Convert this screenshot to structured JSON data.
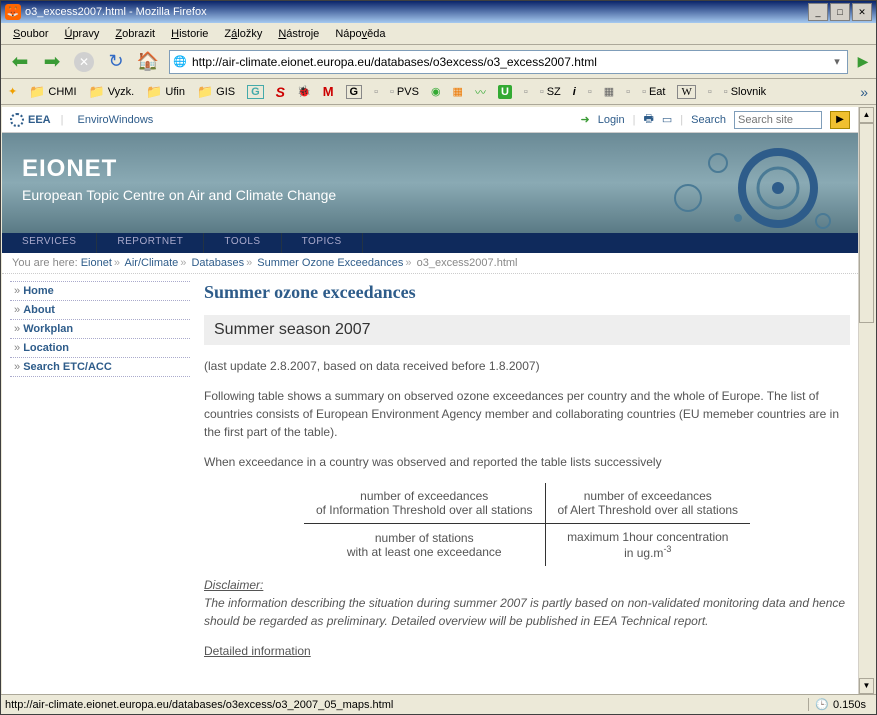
{
  "window": {
    "title": "o3_excess2007.html - Mozilla Firefox"
  },
  "menu": [
    "Soubor",
    "Úpravy",
    "Zobrazit",
    "Historie",
    "Záložky",
    "Nástroje",
    "Nápověda"
  ],
  "url": "http://air-climate.eionet.europa.eu/databases/o3excess/o3_excess2007.html",
  "bookmarks": [
    "CHMI",
    "Vyzk.",
    "Ufin",
    "GIS",
    "G",
    "S",
    "?",
    "M",
    "G",
    "",
    "PVS",
    "",
    "",
    "",
    "U",
    "",
    "SZ",
    "i",
    "",
    "",
    "",
    "Eat",
    "W",
    "",
    "Slovnik"
  ],
  "portal": {
    "eea": "EEA",
    "enviro": "EnviroWindows",
    "login": "Login",
    "search_label": "Search",
    "search_placeholder": "Search site"
  },
  "banner": {
    "title": "EIONET",
    "subtitle": "European Topic Centre on Air and Climate Change"
  },
  "tabs": [
    "SERVICES",
    "REPORTNET",
    "TOOLS",
    "TOPICS"
  ],
  "breadcrumb": {
    "prefix": "You are here:",
    "items": [
      "Eionet",
      "Air/Climate",
      "Databases",
      "Summer Ozone Exceedances"
    ],
    "current": "o3_excess2007.html"
  },
  "sidebar": [
    "Home",
    "About",
    "Workplan",
    "Location",
    "Search ETC/ACC"
  ],
  "main": {
    "h1": "Summer ozone exceedances",
    "h2": "Summer season 2007",
    "update": "(last update 2.8.2007, based on data received before 1.8.2007)",
    "p1": "Following table shows a summary on observed ozone exceedances per country and the whole of Europe. The list of countries consists of European Environment Agency member and collaborating countries (EU memeber countries are in the first part of the table).",
    "p2": "When exceedance in a country was observed and reported the table lists successively",
    "cell1a": "number of exceedances",
    "cell1b": "of Information Threshold over all stations",
    "cell2a": "number of exceedances",
    "cell2b": "of Alert Threshold over all stations",
    "cell3a": "number of stations",
    "cell3b": "with at least one exceedance",
    "cell4a": "maximum 1hour concentration",
    "cell4b": "in ug.m",
    "disclaimer_h": "Disclaimer:",
    "disclaimer_t": "The information describing the situation during summer 2007 is partly based on non-validated monitoring data and hence should be regarded as preliminary. Detailed overview will be published in EEA Technical report.",
    "detailed": "Detailed information"
  },
  "status": {
    "text": "http://air-climate.eionet.europa.eu/databases/o3excess/o3_2007_05_maps.html",
    "time": "0.150s"
  }
}
